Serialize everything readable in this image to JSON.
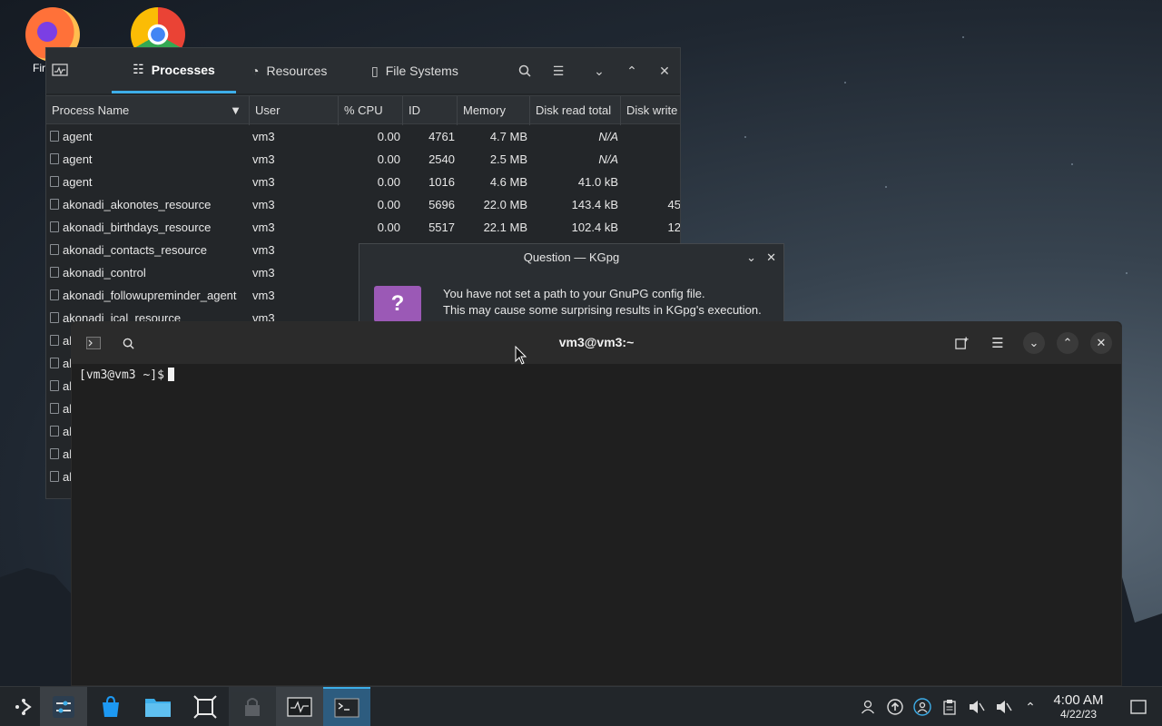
{
  "desktop": {
    "firefox_label": "Fir",
    "colors": {
      "accent": "#3daee9"
    }
  },
  "sysmon": {
    "tabs": [
      {
        "label": "Processes",
        "icon": "list-icon"
      },
      {
        "label": "Resources",
        "icon": "gauge-icon"
      },
      {
        "label": "File Systems",
        "icon": "disk-icon"
      }
    ],
    "columns": [
      "Process Name",
      "User",
      "% CPU",
      "ID",
      "Memory",
      "Disk read total",
      "Disk write"
    ],
    "rows": [
      {
        "name": "agent",
        "user": "vm3",
        "cpu": "0.00",
        "id": "4761",
        "mem": "4.7 MB",
        "read": "N/A",
        "write": ""
      },
      {
        "name": "agent",
        "user": "vm3",
        "cpu": "0.00",
        "id": "2540",
        "mem": "2.5 MB",
        "read": "N/A",
        "write": ""
      },
      {
        "name": "agent",
        "user": "vm3",
        "cpu": "0.00",
        "id": "1016",
        "mem": "4.6 MB",
        "read": "41.0 kB",
        "write": ""
      },
      {
        "name": "akonadi_akonotes_resource",
        "user": "vm3",
        "cpu": "0.00",
        "id": "5696",
        "mem": "22.0 MB",
        "read": "143.4 kB",
        "write": "45"
      },
      {
        "name": "akonadi_birthdays_resource",
        "user": "vm3",
        "cpu": "0.00",
        "id": "5517",
        "mem": "22.1 MB",
        "read": "102.4 kB",
        "write": "12"
      },
      {
        "name": "akonadi_contacts_resource",
        "user": "vm3",
        "cpu": "",
        "id": "",
        "mem": "",
        "read": "",
        "write": ""
      },
      {
        "name": "akonadi_control",
        "user": "vm3",
        "cpu": "",
        "id": "",
        "mem": "",
        "read": "",
        "write": ""
      },
      {
        "name": "akonadi_followupreminder_agent",
        "user": "vm3",
        "cpu": "",
        "id": "",
        "mem": "",
        "read": "",
        "write": ""
      },
      {
        "name": "akonadi_ical_resource",
        "user": "vm3",
        "cpu": "",
        "id": "",
        "mem": "",
        "read": "",
        "write": ""
      },
      {
        "name": "al",
        "user": "",
        "cpu": "",
        "id": "",
        "mem": "",
        "read": "",
        "write": ""
      },
      {
        "name": "al",
        "user": "",
        "cpu": "",
        "id": "",
        "mem": "",
        "read": "",
        "write": ""
      },
      {
        "name": "al",
        "user": "",
        "cpu": "",
        "id": "",
        "mem": "",
        "read": "",
        "write": ""
      },
      {
        "name": "al",
        "user": "",
        "cpu": "",
        "id": "",
        "mem": "",
        "read": "",
        "write": ""
      },
      {
        "name": "al",
        "user": "",
        "cpu": "",
        "id": "",
        "mem": "",
        "read": "",
        "write": ""
      },
      {
        "name": "al",
        "user": "",
        "cpu": "",
        "id": "",
        "mem": "",
        "read": "",
        "write": ""
      },
      {
        "name": "al",
        "user": "",
        "cpu": "",
        "id": "",
        "mem": "",
        "read": "",
        "write": ""
      }
    ]
  },
  "kgpg": {
    "title": "Question — KGpg",
    "line1": "You have not set a path to your GnuPG config file.",
    "line2": "This may cause some surprising results in KGpg's execution.",
    "icon_text": "?"
  },
  "terminal": {
    "title": "vm3@vm3:~",
    "prompt": "[vm3@vm3 ~]$"
  },
  "taskbar": {
    "time": "4:00 AM",
    "date": "4/22/23"
  }
}
